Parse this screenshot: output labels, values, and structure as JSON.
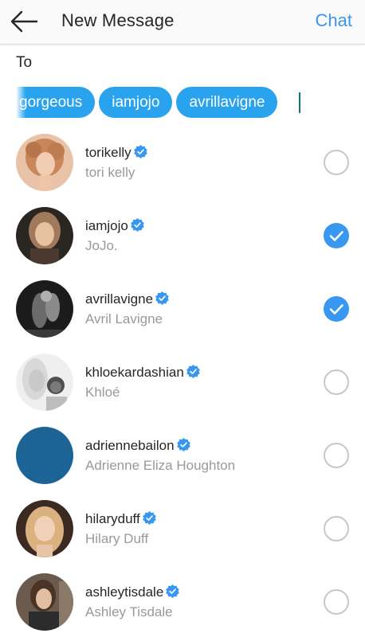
{
  "header": {
    "back_icon": "arrow-left-icon",
    "title": "New Message",
    "action": "Chat",
    "accent": "#3897f0"
  },
  "to": {
    "label": "To",
    "chips": [
      "gorgeous",
      "iamjojo",
      "avrillavigne"
    ]
  },
  "contacts": [
    {
      "username": "torikelly",
      "fullname": "tori kelly",
      "verified": true,
      "selected": false
    },
    {
      "username": "iamjojo",
      "fullname": "JoJo.",
      "verified": true,
      "selected": true
    },
    {
      "username": "avrillavigne",
      "fullname": "Avril Lavigne",
      "verified": true,
      "selected": true
    },
    {
      "username": "khloekardashian",
      "fullname": "Khloé",
      "verified": true,
      "selected": false
    },
    {
      "username": "adriennebailon",
      "fullname": "Adrienne Eliza Houghton",
      "verified": true,
      "selected": false
    },
    {
      "username": "hilaryduff",
      "fullname": "Hilary Duff",
      "verified": true,
      "selected": false
    },
    {
      "username": "ashleytisdale",
      "fullname": "Ashley Tisdale",
      "verified": true,
      "selected": false
    }
  ]
}
